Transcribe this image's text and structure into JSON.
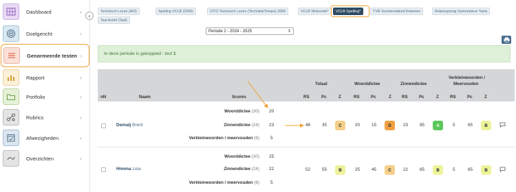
{
  "sidebar": {
    "collapse_icon": "chevron-left-icon",
    "items": [
      {
        "label": "Dashboard",
        "icon": "grid-icon",
        "color": "#e8d9f5"
      },
      {
        "label": "Doelgericht",
        "icon": "target-icon",
        "color": "#d8e8f2"
      },
      {
        "label": "Genormeerde testen",
        "icon": "list-icon",
        "color": "#fbe0d8"
      },
      {
        "label": "Rapport",
        "icon": "chart-icon",
        "color": "#fdf0d8"
      },
      {
        "label": "Portfolio",
        "icon": "folder-icon",
        "color": "#e6f2d8"
      },
      {
        "label": "Rubrics",
        "icon": "network-icon",
        "color": "#e4e4e4"
      },
      {
        "label": "Afwezigheden",
        "icon": "calendar-check-icon",
        "color": "#dce6f0"
      },
      {
        "label": "Overzichten",
        "icon": "link-icon",
        "color": "#e4e4e4"
      }
    ]
  },
  "tabs": [
    "Technisch Lezen (AVI)",
    "Spelling VCLB (2006)",
    "CITO Technisch Lezen (Techniek/Tempo) 2009",
    "VCLB Wiskunde*",
    "VCLB Spelling*",
    "TVR Voorbereidend Rekenen",
    "Rekensprong Summatieve Toets",
    "Taal Actief (Taal)"
  ],
  "period": {
    "selected": "Periode 2 - 2024 - 2025"
  },
  "alert": {
    "text": "In deze periode is gekoppeld : test",
    "count": "1"
  },
  "table": {
    "headers": {
      "nn": "nN",
      "naam": "Naam",
      "scores": "Scores",
      "totaal": "Totaal",
      "woorddictee": "Woorddictee",
      "zinnendictee": "Zinnendictee",
      "verklein": "Verkleinwoorden /",
      "verklein2": "Meervouden",
      "rs": "RS",
      "pc": "Pc",
      "z": "Z"
    },
    "rows": [
      {
        "last": "Demalj",
        "first": "Brent",
        "scores": [
          {
            "label": "Woorddictee",
            "max": "(30)",
            "value": "20"
          },
          {
            "label": "Zinnendictee",
            "max": "(24)",
            "value": "23"
          },
          {
            "label": "Verkleinwoorden / meervouden",
            "max": "(6)",
            "value": "5"
          }
        ],
        "totaal": {
          "rs": "48",
          "pc": "35",
          "z": "C"
        },
        "woord": {
          "rs": "20",
          "pc": "15",
          "z": "D"
        },
        "zin": {
          "rs": "23",
          "pc": "85",
          "z": "A"
        },
        "verklein": {
          "rs": "5",
          "pc": "65",
          "z": "B"
        }
      },
      {
        "last": "Himma",
        "first": "Leia",
        "scores": [
          {
            "label": "Woorddictee",
            "max": "(30)",
            "value": "25"
          },
          {
            "label": "Zinnendictee",
            "max": "(24)",
            "value": "22"
          },
          {
            "label": "Verkleinwoorden / meervouden",
            "max": "(6)",
            "value": "5"
          }
        ],
        "totaal": {
          "rs": "52",
          "pc": "55",
          "z": "B"
        },
        "woord": {
          "rs": "25",
          "pc": "45",
          "z": "C"
        },
        "zin": {
          "rs": "22",
          "pc": "65",
          "z": "B"
        },
        "verklein": {
          "rs": "5",
          "pc": "65",
          "z": "B"
        }
      }
    ]
  },
  "colors": {
    "A": "#5cc85c",
    "B": "#eef29a",
    "C": "#f5d08a",
    "D": "#f0a040",
    "accent_outline": "#f0a030",
    "header_bg": "#d4d6d8"
  }
}
